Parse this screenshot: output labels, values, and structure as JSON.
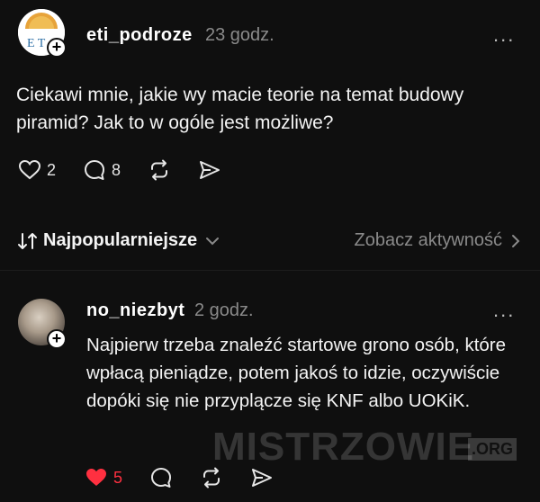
{
  "post": {
    "username": "eti_podroze",
    "time": "23 godz.",
    "more": "...",
    "text": "Ciekawi mnie, jakie wy macie teorie na temat budowy piramid? Jak to w ogóle jest możliwe?",
    "avatar_letters": "E T",
    "actions": {
      "likes": "2",
      "comments": "8"
    }
  },
  "sort": {
    "label": "Najpopularniejsze",
    "activity_link": "Zobacz aktywność"
  },
  "reply": {
    "username": "no_niezbyt",
    "time": "2 godz.",
    "more": "...",
    "text": "Najpierw trzeba znaleźć startowe grono osób, które wpłacą pieniądze, potem jakoś to idzie, oczywiście dopóki się nie przyplącze się KNF albo UOKiK.",
    "actions": {
      "likes": "5"
    }
  },
  "watermark": {
    "text": "MISTRZOWIE",
    "domain": ".ORG"
  },
  "colors": {
    "background": "#0f0f0f",
    "like_active": "#ff3040",
    "muted": "#8a8a8a"
  },
  "icons": [
    "heart-icon",
    "comment-icon",
    "repost-icon",
    "share-icon",
    "sort-icon",
    "chevron-down-icon",
    "chevron-right-icon",
    "plus-icon",
    "more-icon"
  ]
}
